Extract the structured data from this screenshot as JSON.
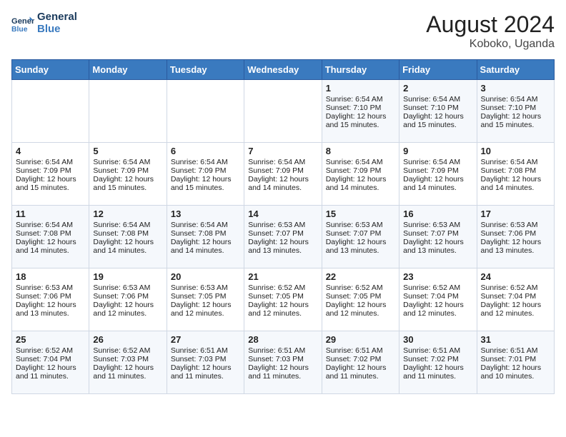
{
  "header": {
    "logo_line1": "General",
    "logo_line2": "Blue",
    "month_year": "August 2024",
    "location": "Koboko, Uganda"
  },
  "days_of_week": [
    "Sunday",
    "Monday",
    "Tuesday",
    "Wednesday",
    "Thursday",
    "Friday",
    "Saturday"
  ],
  "weeks": [
    [
      {
        "day": "",
        "sunrise": "",
        "sunset": "",
        "daylight": ""
      },
      {
        "day": "",
        "sunrise": "",
        "sunset": "",
        "daylight": ""
      },
      {
        "day": "",
        "sunrise": "",
        "sunset": "",
        "daylight": ""
      },
      {
        "day": "",
        "sunrise": "",
        "sunset": "",
        "daylight": ""
      },
      {
        "day": "1",
        "sunrise": "Sunrise: 6:54 AM",
        "sunset": "Sunset: 7:10 PM",
        "daylight": "Daylight: 12 hours and 15 minutes."
      },
      {
        "day": "2",
        "sunrise": "Sunrise: 6:54 AM",
        "sunset": "Sunset: 7:10 PM",
        "daylight": "Daylight: 12 hours and 15 minutes."
      },
      {
        "day": "3",
        "sunrise": "Sunrise: 6:54 AM",
        "sunset": "Sunset: 7:10 PM",
        "daylight": "Daylight: 12 hours and 15 minutes."
      }
    ],
    [
      {
        "day": "4",
        "sunrise": "Sunrise: 6:54 AM",
        "sunset": "Sunset: 7:09 PM",
        "daylight": "Daylight: 12 hours and 15 minutes."
      },
      {
        "day": "5",
        "sunrise": "Sunrise: 6:54 AM",
        "sunset": "Sunset: 7:09 PM",
        "daylight": "Daylight: 12 hours and 15 minutes."
      },
      {
        "day": "6",
        "sunrise": "Sunrise: 6:54 AM",
        "sunset": "Sunset: 7:09 PM",
        "daylight": "Daylight: 12 hours and 15 minutes."
      },
      {
        "day": "7",
        "sunrise": "Sunrise: 6:54 AM",
        "sunset": "Sunset: 7:09 PM",
        "daylight": "Daylight: 12 hours and 14 minutes."
      },
      {
        "day": "8",
        "sunrise": "Sunrise: 6:54 AM",
        "sunset": "Sunset: 7:09 PM",
        "daylight": "Daylight: 12 hours and 14 minutes."
      },
      {
        "day": "9",
        "sunrise": "Sunrise: 6:54 AM",
        "sunset": "Sunset: 7:09 PM",
        "daylight": "Daylight: 12 hours and 14 minutes."
      },
      {
        "day": "10",
        "sunrise": "Sunrise: 6:54 AM",
        "sunset": "Sunset: 7:08 PM",
        "daylight": "Daylight: 12 hours and 14 minutes."
      }
    ],
    [
      {
        "day": "11",
        "sunrise": "Sunrise: 6:54 AM",
        "sunset": "Sunset: 7:08 PM",
        "daylight": "Daylight: 12 hours and 14 minutes."
      },
      {
        "day": "12",
        "sunrise": "Sunrise: 6:54 AM",
        "sunset": "Sunset: 7:08 PM",
        "daylight": "Daylight: 12 hours and 14 minutes."
      },
      {
        "day": "13",
        "sunrise": "Sunrise: 6:54 AM",
        "sunset": "Sunset: 7:08 PM",
        "daylight": "Daylight: 12 hours and 14 minutes."
      },
      {
        "day": "14",
        "sunrise": "Sunrise: 6:53 AM",
        "sunset": "Sunset: 7:07 PM",
        "daylight": "Daylight: 12 hours and 13 minutes."
      },
      {
        "day": "15",
        "sunrise": "Sunrise: 6:53 AM",
        "sunset": "Sunset: 7:07 PM",
        "daylight": "Daylight: 12 hours and 13 minutes."
      },
      {
        "day": "16",
        "sunrise": "Sunrise: 6:53 AM",
        "sunset": "Sunset: 7:07 PM",
        "daylight": "Daylight: 12 hours and 13 minutes."
      },
      {
        "day": "17",
        "sunrise": "Sunrise: 6:53 AM",
        "sunset": "Sunset: 7:06 PM",
        "daylight": "Daylight: 12 hours and 13 minutes."
      }
    ],
    [
      {
        "day": "18",
        "sunrise": "Sunrise: 6:53 AM",
        "sunset": "Sunset: 7:06 PM",
        "daylight": "Daylight: 12 hours and 13 minutes."
      },
      {
        "day": "19",
        "sunrise": "Sunrise: 6:53 AM",
        "sunset": "Sunset: 7:06 PM",
        "daylight": "Daylight: 12 hours and 12 minutes."
      },
      {
        "day": "20",
        "sunrise": "Sunrise: 6:53 AM",
        "sunset": "Sunset: 7:05 PM",
        "daylight": "Daylight: 12 hours and 12 minutes."
      },
      {
        "day": "21",
        "sunrise": "Sunrise: 6:52 AM",
        "sunset": "Sunset: 7:05 PM",
        "daylight": "Daylight: 12 hours and 12 minutes."
      },
      {
        "day": "22",
        "sunrise": "Sunrise: 6:52 AM",
        "sunset": "Sunset: 7:05 PM",
        "daylight": "Daylight: 12 hours and 12 minutes."
      },
      {
        "day": "23",
        "sunrise": "Sunrise: 6:52 AM",
        "sunset": "Sunset: 7:04 PM",
        "daylight": "Daylight: 12 hours and 12 minutes."
      },
      {
        "day": "24",
        "sunrise": "Sunrise: 6:52 AM",
        "sunset": "Sunset: 7:04 PM",
        "daylight": "Daylight: 12 hours and 12 minutes."
      }
    ],
    [
      {
        "day": "25",
        "sunrise": "Sunrise: 6:52 AM",
        "sunset": "Sunset: 7:04 PM",
        "daylight": "Daylight: 12 hours and 11 minutes."
      },
      {
        "day": "26",
        "sunrise": "Sunrise: 6:52 AM",
        "sunset": "Sunset: 7:03 PM",
        "daylight": "Daylight: 12 hours and 11 minutes."
      },
      {
        "day": "27",
        "sunrise": "Sunrise: 6:51 AM",
        "sunset": "Sunset: 7:03 PM",
        "daylight": "Daylight: 12 hours and 11 minutes."
      },
      {
        "day": "28",
        "sunrise": "Sunrise: 6:51 AM",
        "sunset": "Sunset: 7:03 PM",
        "daylight": "Daylight: 12 hours and 11 minutes."
      },
      {
        "day": "29",
        "sunrise": "Sunrise: 6:51 AM",
        "sunset": "Sunset: 7:02 PM",
        "daylight": "Daylight: 12 hours and 11 minutes."
      },
      {
        "day": "30",
        "sunrise": "Sunrise: 6:51 AM",
        "sunset": "Sunset: 7:02 PM",
        "daylight": "Daylight: 12 hours and 11 minutes."
      },
      {
        "day": "31",
        "sunrise": "Sunrise: 6:51 AM",
        "sunset": "Sunset: 7:01 PM",
        "daylight": "Daylight: 12 hours and 10 minutes."
      }
    ]
  ]
}
